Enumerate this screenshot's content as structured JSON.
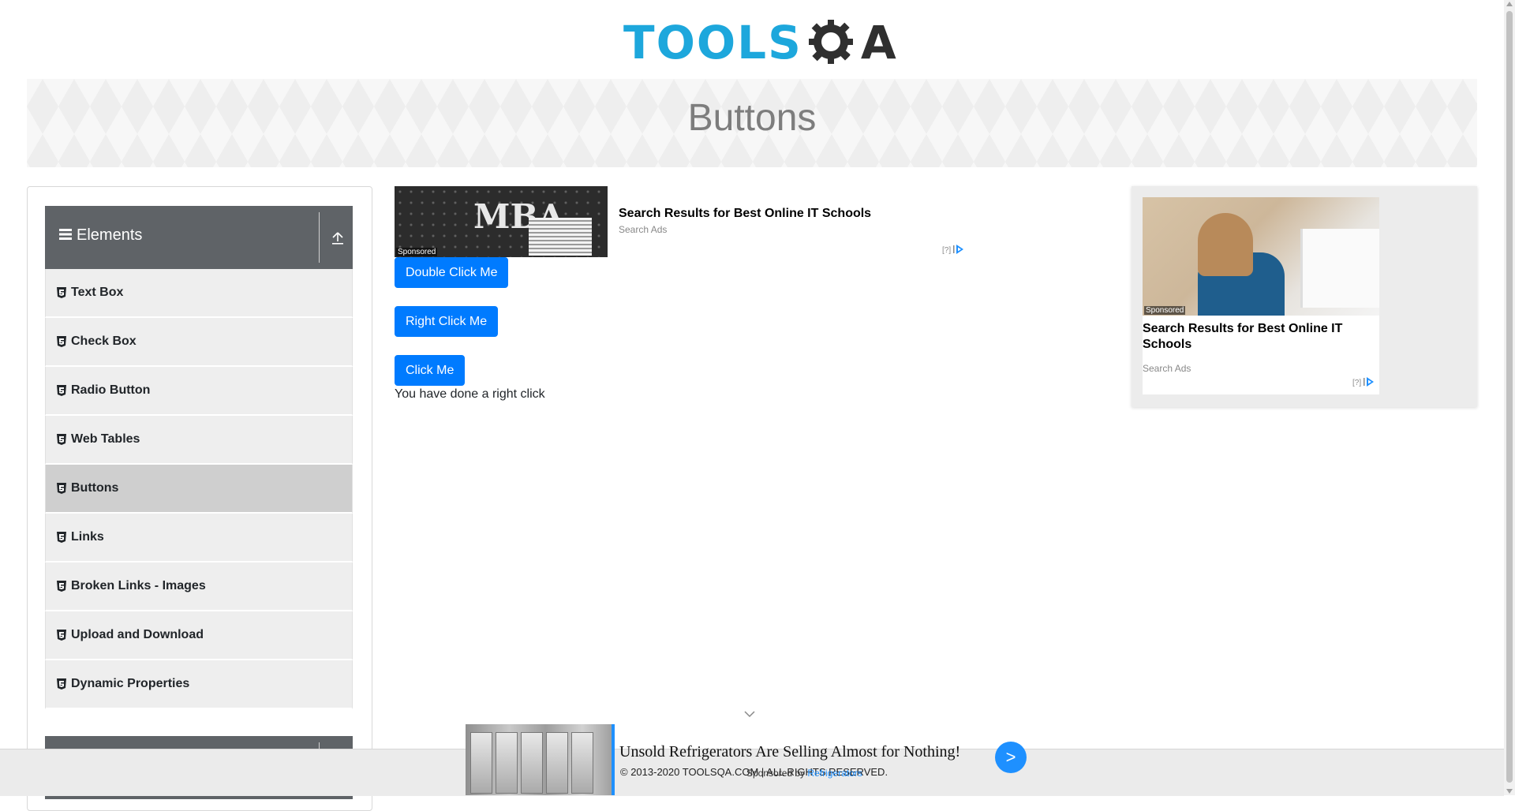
{
  "header": {
    "logo_text": "TOOLS",
    "logo_suffix": "A",
    "logo_colors": {
      "primary": "#1da7dc",
      "secondary": "#2f2f2f"
    }
  },
  "banner": {
    "title": "Buttons"
  },
  "sidebar": {
    "groups": [
      {
        "label": "Elements",
        "icon": "hamburger-icon",
        "toggle_icon": "collapse-arrow-icon"
      },
      {
        "label": "",
        "icon": "hamburger-icon",
        "toggle_icon": "collapse-arrow-icon"
      }
    ],
    "items": [
      {
        "label": "Text Box",
        "icon": "html5-icon"
      },
      {
        "label": "Check Box",
        "icon": "html5-icon"
      },
      {
        "label": "Radio Button",
        "icon": "html5-icon"
      },
      {
        "label": "Web Tables",
        "icon": "html5-icon"
      },
      {
        "label": "Buttons",
        "icon": "html5-icon",
        "active": true
      },
      {
        "label": "Links",
        "icon": "html5-icon"
      },
      {
        "label": "Broken Links - Images",
        "icon": "html5-icon"
      },
      {
        "label": "Upload and Download",
        "icon": "html5-icon"
      },
      {
        "label": "Dynamic Properties",
        "icon": "html5-icon"
      }
    ]
  },
  "main": {
    "buttons": {
      "double_click": "Double Click Me",
      "right_click": "Right Click Me",
      "click": "Click Me"
    },
    "result_message": "You have done a right click",
    "button_color": "#007bff"
  },
  "ads": {
    "inline": {
      "image_text": "MBA",
      "sponsored": "Sponsored",
      "title": "Search Results for Best Online IT Schools",
      "subtitle": "Search Ads",
      "info": "[?]"
    },
    "right": {
      "sponsored": "Sponsored",
      "title": "Search Results for Best Online IT Schools",
      "subtitle": "Search Ads",
      "info": "[?]"
    },
    "bottom": {
      "title": "Unsold Refrigerators Are Selling Almost for Nothing!",
      "sponsored_prefix": "Sponsored by ",
      "sponsor": "Refrigerators",
      "go": ">"
    }
  },
  "footer": {
    "text": "© 2013-2020 TOOLSQA.COM | ALL RIGHTS RESERVED."
  }
}
